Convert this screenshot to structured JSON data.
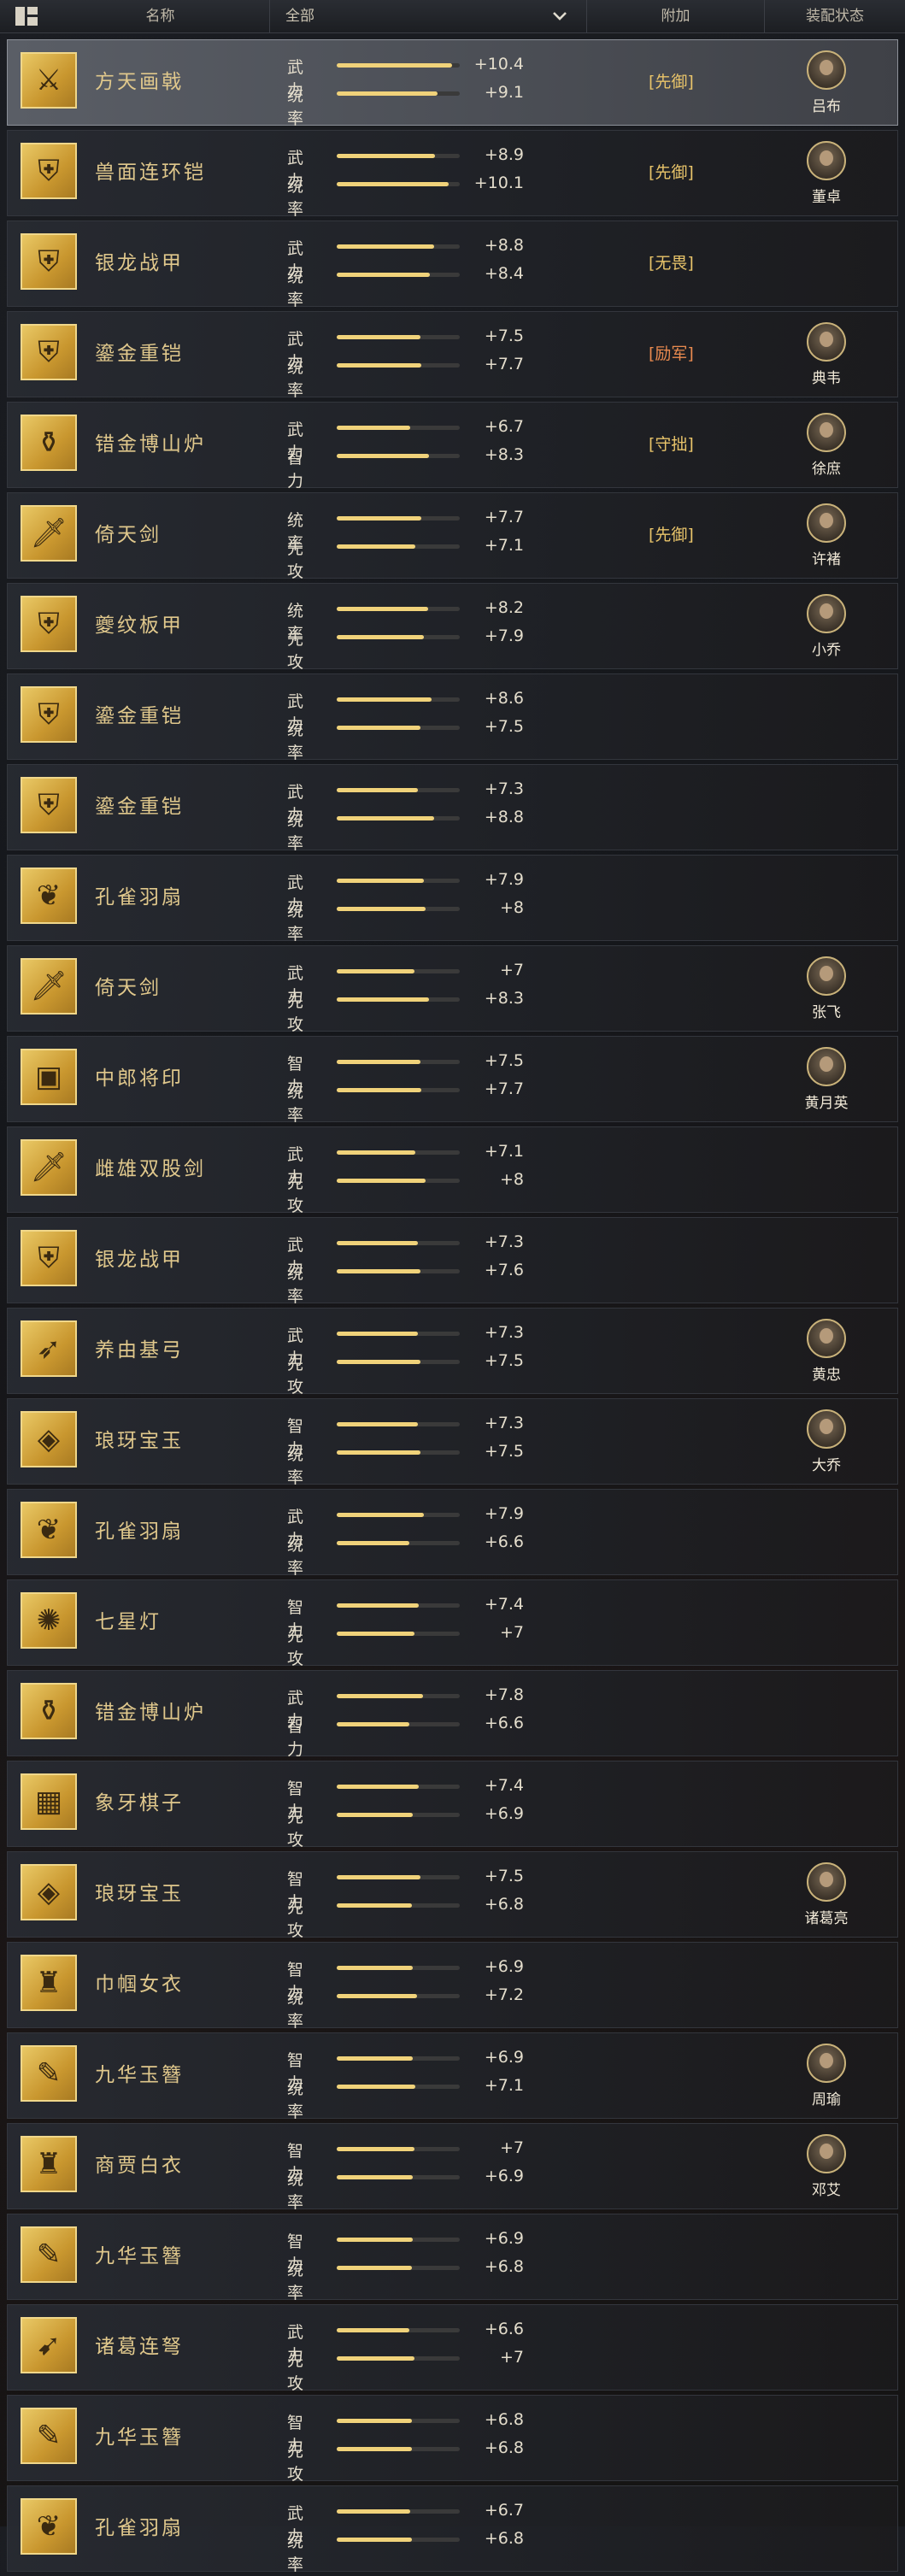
{
  "header": {
    "columns": {
      "name": "名称",
      "bonus": "附加",
      "status": "装配状态"
    },
    "filter": {
      "value": "全部"
    }
  },
  "colors": {
    "accent": "#f0d27a",
    "bonus_gold": "#e9c46a",
    "bonus_orange": "#e98a4f"
  },
  "items": [
    {
      "name": "方天画戟",
      "icon": "halberd-icon",
      "s1": {
        "label": "武力",
        "value": "+10.4",
        "fill": 0.94
      },
      "s2": {
        "label": "统率",
        "value": "+9.1",
        "fill": 0.82
      },
      "bonus": "[先御]",
      "general": "吕布",
      "selected": true
    },
    {
      "name": "兽面连环铠",
      "icon": "armor-icon",
      "s1": {
        "label": "武力",
        "value": "+8.9",
        "fill": 0.8
      },
      "s2": {
        "label": "统率",
        "value": "+10.1",
        "fill": 0.91
      },
      "bonus": "[先御]",
      "general": "董卓"
    },
    {
      "name": "银龙战甲",
      "icon": "armor-icon",
      "s1": {
        "label": "武力",
        "value": "+8.8",
        "fill": 0.79
      },
      "s2": {
        "label": "统率",
        "value": "+8.4",
        "fill": 0.76
      },
      "bonus": "[无畏]",
      "general": ""
    },
    {
      "name": "鎏金重铠",
      "icon": "armor-icon",
      "s1": {
        "label": "武力",
        "value": "+7.5",
        "fill": 0.68
      },
      "s2": {
        "label": "统率",
        "value": "+7.7",
        "fill": 0.69
      },
      "bonus": "[励军]",
      "bonus_red": true,
      "general": "典韦"
    },
    {
      "name": "错金博山炉",
      "icon": "censer-icon",
      "s1": {
        "label": "武力",
        "value": "+6.7",
        "fill": 0.6
      },
      "s2": {
        "label": "智力",
        "value": "+8.3",
        "fill": 0.75
      },
      "bonus": "[守拙]",
      "general": "徐庶"
    },
    {
      "name": "倚天剑",
      "icon": "sword-icon",
      "s1": {
        "label": "统率",
        "value": "+7.7",
        "fill": 0.69
      },
      "s2": {
        "label": "先攻",
        "value": "+7.1",
        "fill": 0.64
      },
      "bonus": "[先御]",
      "general": "许褚"
    },
    {
      "name": "夔纹板甲",
      "icon": "armor-icon",
      "s1": {
        "label": "统率",
        "value": "+8.2",
        "fill": 0.74
      },
      "s2": {
        "label": "先攻",
        "value": "+7.9",
        "fill": 0.71
      },
      "bonus": "",
      "general": "小乔"
    },
    {
      "name": "鎏金重铠",
      "icon": "armor-icon",
      "s1": {
        "label": "武力",
        "value": "+8.6",
        "fill": 0.77
      },
      "s2": {
        "label": "统率",
        "value": "+7.5",
        "fill": 0.68
      },
      "bonus": "",
      "general": ""
    },
    {
      "name": "鎏金重铠",
      "icon": "armor-icon",
      "s1": {
        "label": "武力",
        "value": "+7.3",
        "fill": 0.66
      },
      "s2": {
        "label": "统率",
        "value": "+8.8",
        "fill": 0.79
      },
      "bonus": "",
      "general": ""
    },
    {
      "name": "孔雀羽扇",
      "icon": "fan-icon",
      "s1": {
        "label": "武力",
        "value": "+7.9",
        "fill": 0.71
      },
      "s2": {
        "label": "统率",
        "value": "+8",
        "fill": 0.72
      },
      "bonus": "",
      "general": ""
    },
    {
      "name": "倚天剑",
      "icon": "sword-icon",
      "s1": {
        "label": "武力",
        "value": "+7",
        "fill": 0.63
      },
      "s2": {
        "label": "先攻",
        "value": "+8.3",
        "fill": 0.75
      },
      "bonus": "",
      "general": "张飞"
    },
    {
      "name": "中郎将印",
      "icon": "seal-icon",
      "s1": {
        "label": "智力",
        "value": "+7.5",
        "fill": 0.68
      },
      "s2": {
        "label": "统率",
        "value": "+7.7",
        "fill": 0.69
      },
      "bonus": "",
      "general": "黄月英"
    },
    {
      "name": "雌雄双股剑",
      "icon": "sword-icon",
      "s1": {
        "label": "武力",
        "value": "+7.1",
        "fill": 0.64
      },
      "s2": {
        "label": "先攻",
        "value": "+8",
        "fill": 0.72
      },
      "bonus": "",
      "general": ""
    },
    {
      "name": "银龙战甲",
      "icon": "armor-icon",
      "s1": {
        "label": "武力",
        "value": "+7.3",
        "fill": 0.66
      },
      "s2": {
        "label": "统率",
        "value": "+7.6",
        "fill": 0.68
      },
      "bonus": "",
      "general": ""
    },
    {
      "name": "养由基弓",
      "icon": "bow-icon",
      "s1": {
        "label": "武力",
        "value": "+7.3",
        "fill": 0.66
      },
      "s2": {
        "label": "先攻",
        "value": "+7.5",
        "fill": 0.68
      },
      "bonus": "",
      "general": "黄忠"
    },
    {
      "name": "琅玡宝玉",
      "icon": "jade-icon",
      "s1": {
        "label": "智力",
        "value": "+7.3",
        "fill": 0.66
      },
      "s2": {
        "label": "统率",
        "value": "+7.5",
        "fill": 0.68
      },
      "bonus": "",
      "general": "大乔"
    },
    {
      "name": "孔雀羽扇",
      "icon": "fan-icon",
      "s1": {
        "label": "武力",
        "value": "+7.9",
        "fill": 0.71
      },
      "s2": {
        "label": "统率",
        "value": "+6.6",
        "fill": 0.59
      },
      "bonus": "",
      "general": ""
    },
    {
      "name": "七星灯",
      "icon": "lamp-icon",
      "s1": {
        "label": "智力",
        "value": "+7.4",
        "fill": 0.67
      },
      "s2": {
        "label": "先攻",
        "value": "+7",
        "fill": 0.63
      },
      "bonus": "",
      "general": ""
    },
    {
      "name": "错金博山炉",
      "icon": "censer-icon",
      "s1": {
        "label": "武力",
        "value": "+7.8",
        "fill": 0.7
      },
      "s2": {
        "label": "智力",
        "value": "+6.6",
        "fill": 0.59
      },
      "bonus": "",
      "general": ""
    },
    {
      "name": "象牙棋子",
      "icon": "chess-icon",
      "s1": {
        "label": "智力",
        "value": "+7.4",
        "fill": 0.67
      },
      "s2": {
        "label": "先攻",
        "value": "+6.9",
        "fill": 0.62
      },
      "bonus": "",
      "general": ""
    },
    {
      "name": "琅玡宝玉",
      "icon": "jade-icon",
      "s1": {
        "label": "智力",
        "value": "+7.5",
        "fill": 0.68
      },
      "s2": {
        "label": "先攻",
        "value": "+6.8",
        "fill": 0.61
      },
      "bonus": "",
      "general": "诸葛亮"
    },
    {
      "name": "巾帼女衣",
      "icon": "robe-icon",
      "s1": {
        "label": "智力",
        "value": "+6.9",
        "fill": 0.62
      },
      "s2": {
        "label": "统率",
        "value": "+7.2",
        "fill": 0.65
      },
      "bonus": "",
      "general": ""
    },
    {
      "name": "九华玉簪",
      "icon": "hairpin-icon",
      "s1": {
        "label": "智力",
        "value": "+6.9",
        "fill": 0.62
      },
      "s2": {
        "label": "统率",
        "value": "+7.1",
        "fill": 0.64
      },
      "bonus": "",
      "general": "周瑜"
    },
    {
      "name": "商贾白衣",
      "icon": "robe-icon",
      "s1": {
        "label": "智力",
        "value": "+7",
        "fill": 0.63
      },
      "s2": {
        "label": "统率",
        "value": "+6.9",
        "fill": 0.62
      },
      "bonus": "",
      "general": "邓艾"
    },
    {
      "name": "九华玉簪",
      "icon": "hairpin-icon",
      "s1": {
        "label": "智力",
        "value": "+6.9",
        "fill": 0.62
      },
      "s2": {
        "label": "统率",
        "value": "+6.8",
        "fill": 0.61
      },
      "bonus": "",
      "general": ""
    },
    {
      "name": "诸葛连弩",
      "icon": "crossbow-icon",
      "s1": {
        "label": "武力",
        "value": "+6.6",
        "fill": 0.59
      },
      "s2": {
        "label": "先攻",
        "value": "+7",
        "fill": 0.63
      },
      "bonus": "",
      "general": ""
    },
    {
      "name": "九华玉簪",
      "icon": "hairpin-icon",
      "s1": {
        "label": "智力",
        "value": "+6.8",
        "fill": 0.61
      },
      "s2": {
        "label": "先攻",
        "value": "+6.8",
        "fill": 0.61
      },
      "bonus": "",
      "general": ""
    },
    {
      "name": "孔雀羽扇",
      "icon": "fan-icon",
      "s1": {
        "label": "武力",
        "value": "+6.7",
        "fill": 0.6
      },
      "s2": {
        "label": "统率",
        "value": "+6.8",
        "fill": 0.61
      },
      "bonus": "",
      "general": ""
    }
  ]
}
